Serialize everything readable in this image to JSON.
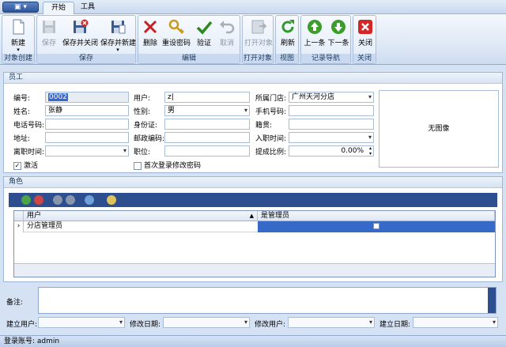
{
  "tabs": [
    {
      "label": "开始"
    },
    {
      "label": "工具"
    }
  ],
  "ribbon": {
    "groups": [
      "对象创建",
      "保存",
      "编辑",
      "打开对象",
      "视图",
      "记录导航",
      "关闭"
    ],
    "buttons": {
      "new": "新建",
      "save": "保存",
      "save_close": "保存并关闭",
      "save_new": "保存并新建",
      "delete": "删除",
      "reset_pwd": "重设密码",
      "validate": "验证",
      "cancel": "取消",
      "open_obj": "打开对象",
      "refresh": "刷新",
      "prev": "上一条",
      "next": "下一条",
      "close": "关闭"
    }
  },
  "employee": {
    "title": "员工",
    "labels": {
      "id": "编号:",
      "user": "用户:",
      "store": "所属门店:",
      "name": "姓名:",
      "gender": "性别:",
      "mobile": "手机号码:",
      "phone": "电话号码:",
      "idcard": "身份证:",
      "origin": "籍贯:",
      "address": "地址:",
      "zip": "邮政编码:",
      "hire": "入职时间:",
      "leave": "离职时间:",
      "post": "职位:",
      "commission": "提成比例:"
    },
    "values": {
      "id": "0002",
      "user": "z|",
      "store": "广州天河分店",
      "name": "张静",
      "gender": "男",
      "commission": "0.00%"
    },
    "photo": "无图像",
    "active": "激活",
    "first_login": "首次登录修改密码"
  },
  "roles": {
    "title": "角色",
    "columns": [
      "用户",
      "是管理员"
    ],
    "rows": [
      {
        "user": "分店管理员"
      }
    ]
  },
  "footer": {
    "note": "备注:",
    "creator": "建立用户:",
    "modified_date": "修改日期:",
    "modifier": "修改用户:",
    "created_date": "建立日期:"
  },
  "status": "登录账号: admin"
}
